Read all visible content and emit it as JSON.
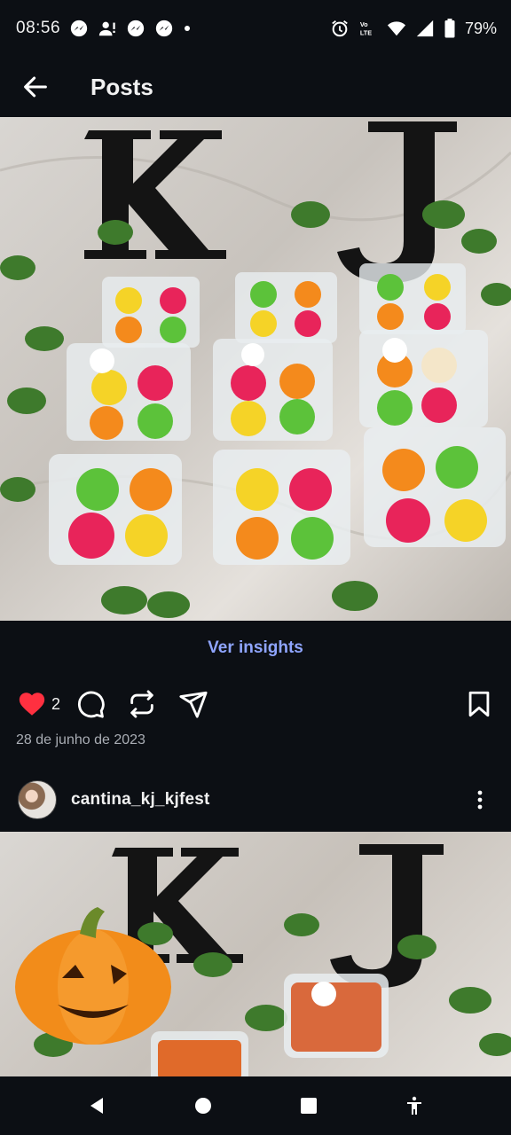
{
  "status_bar": {
    "time": "08:56",
    "notification_icons": [
      "messenger-icon",
      "person-alert-icon",
      "messenger-icon",
      "messenger-icon",
      "dot-icon"
    ],
    "system_icons": [
      "alarm-icon",
      "volte-icon",
      "wifi-icon",
      "cell-signal-icon",
      "battery-icon"
    ],
    "battery": "79%"
  },
  "header": {
    "back_icon": "back-arrow-icon",
    "title": "Posts"
  },
  "post": {
    "image_description_icon": "photo",
    "insights_label": "Ver insights",
    "like_count": "2",
    "date": "28 de junho de 2023"
  },
  "next_post": {
    "username": "cantina_kj_kjfest"
  },
  "colors": {
    "background": "#0c0f14",
    "accent_link": "#8fa5ff",
    "like_red": "#ff3040"
  },
  "nav_bar": {
    "icons": [
      "nav-back-icon",
      "nav-home-icon",
      "nav-recents-icon",
      "accessibility-icon"
    ]
  }
}
